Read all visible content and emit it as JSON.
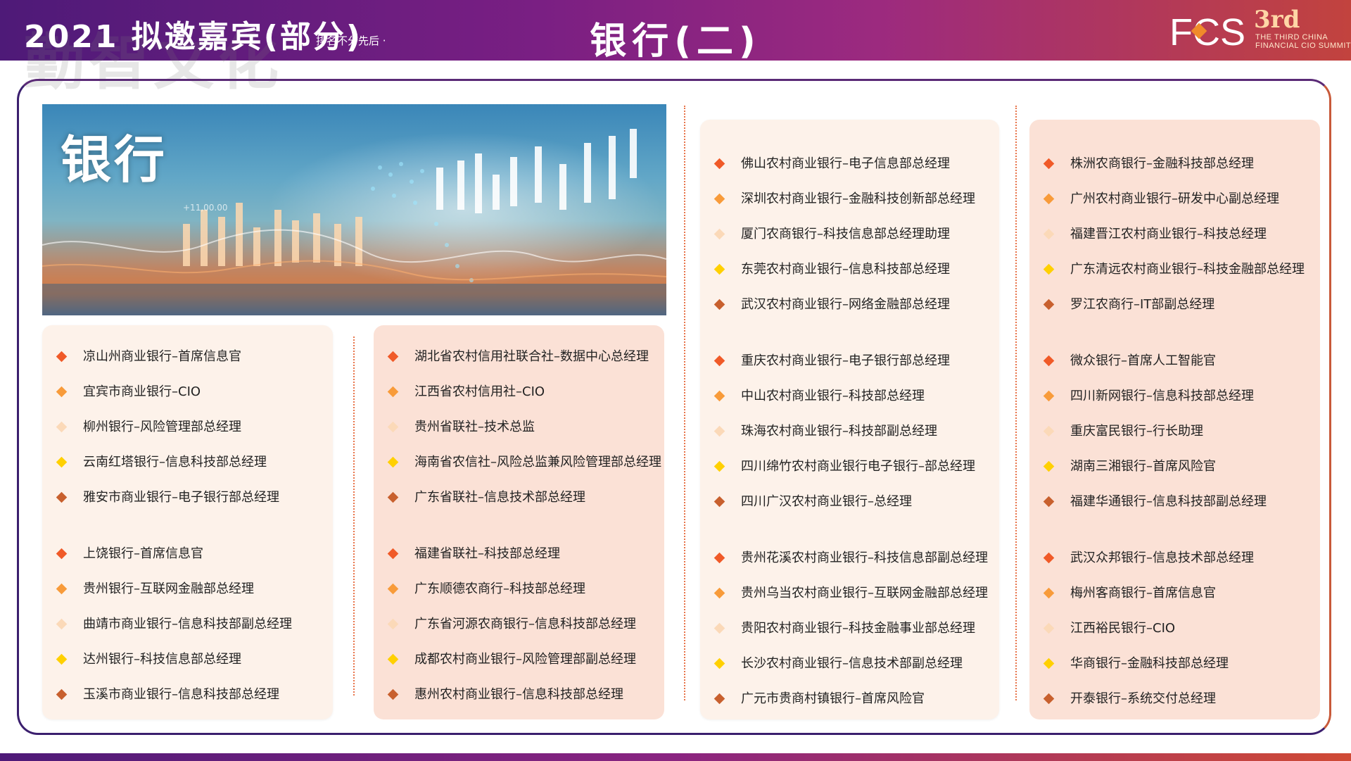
{
  "header": {
    "watermark": "勤智文化",
    "title": "2021 拟邀嘉宾(部分)",
    "note": "排名不分先后 ·",
    "page_title": "银行(二)",
    "logo": {
      "text": "FCS",
      "edition": "3rd",
      "line1": "THE THIRD CHINA",
      "line2": "FINANCIAL CIO SUMMIT"
    }
  },
  "hero": {
    "title": "银行",
    "tick_label": "+11,00.00"
  },
  "colors": {
    "bullets": [
      "#f05a28",
      "#f89b3a",
      "#fbd9b8",
      "#ffd000",
      "#c8602e"
    ]
  },
  "columns": [
    {
      "groups": [
        [
          "凉山州商业银行–首席信息官",
          "宜宾市商业银行–CIO",
          "柳州银行–风险管理部总经理",
          "云南红塔银行–信息科技部总经理",
          "雅安市商业银行–电子银行部总经理"
        ],
        [
          "上饶银行–首席信息官",
          "贵州银行–互联网金融部总经理",
          "曲靖市商业银行–信息科技部副总经理",
          "达州银行–科技信息部总经理",
          "玉溪市商业银行–信息科技部总经理"
        ]
      ]
    },
    {
      "groups": [
        [
          "湖北省农村信用社联合社–数据中心总经理",
          "江西省农村信用社–CIO",
          "贵州省联社–技术总监",
          "海南省农信社–风险总监兼风险管理部总经理",
          "广东省联社–信息技术部总经理"
        ],
        [
          "福建省联社–科技部总经理",
          "广东顺德农商行–科技部总经理",
          "广东省河源农商银行–信息科技部总经理",
          "成都农村商业银行–风险管理部副总经理",
          "惠州农村商业银行–信息科技部总经理"
        ]
      ]
    },
    {
      "groups": [
        [
          "佛山农村商业银行–电子信息部总经理",
          "深圳农村商业银行–金融科技创新部总经理",
          "厦门农商银行–科技信息部总经理助理",
          "东莞农村商业银行–信息科技部总经理",
          "武汉农村商业银行–网络金融部总经理"
        ],
        [
          "重庆农村商业银行–电子银行部总经理",
          "中山农村商业银行–科技部总经理",
          "珠海农村商业银行–科技部副总经理",
          "四川绵竹农村商业银行电子银行–部总经理",
          "四川广汉农村商业银行–总经理"
        ],
        [
          "贵州花溪农村商业银行–科技信息部副总经理",
          "贵州乌当农村商业银行–互联网金融部总经理",
          "贵阳农村商业银行–科技金融事业部总经理",
          "长沙农村商业银行–信息技术部副总经理",
          "广元市贵商村镇银行–首席风险官"
        ]
      ]
    },
    {
      "groups": [
        [
          "株洲农商银行–金融科技部总经理",
          "广州农村商业银行–研发中心副总经理",
          "福建晋江农村商业银行–科技总经理",
          "广东清远农村商业银行–科技金融部总经理",
          "罗江农商行–IT部副总经理"
        ],
        [
          "微众银行–首席人工智能官",
          "四川新网银行–信息科技部总经理",
          "重庆富民银行–行长助理",
          "湖南三湘银行–首席风险官",
          "福建华通银行–信息科技部副总经理"
        ],
        [
          "武汉众邦银行–信息技术部总经理",
          "梅州客商银行–首席信息官",
          "江西裕民银行–CIO",
          "华商银行–金融科技部总经理",
          "开泰银行–系统交付总经理"
        ]
      ]
    }
  ]
}
